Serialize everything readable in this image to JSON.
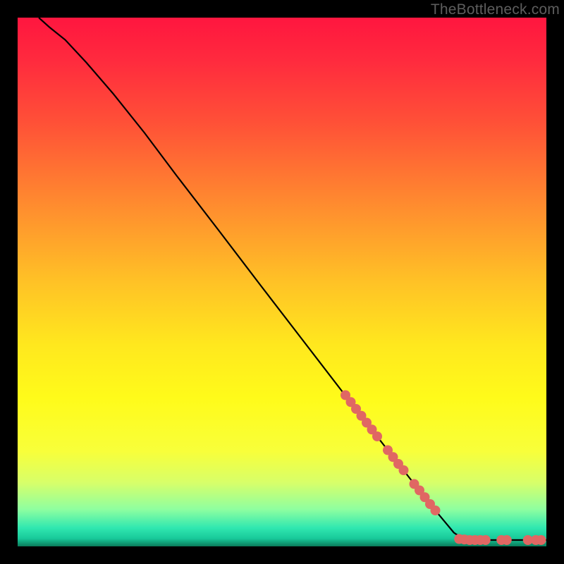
{
  "watermark": "TheBottleneck.com",
  "chart_data": {
    "type": "line",
    "title": "",
    "xlabel": "",
    "ylabel": "",
    "xlim": [
      0,
      100
    ],
    "ylim": [
      0,
      100
    ],
    "gradient_stops": [
      {
        "offset": 0.0,
        "color": "#ff163f"
      },
      {
        "offset": 0.08,
        "color": "#ff2a3e"
      },
      {
        "offset": 0.2,
        "color": "#ff5137"
      },
      {
        "offset": 0.35,
        "color": "#ff8a2f"
      },
      {
        "offset": 0.5,
        "color": "#ffc226"
      },
      {
        "offset": 0.62,
        "color": "#ffe81e"
      },
      {
        "offset": 0.72,
        "color": "#fffb1a"
      },
      {
        "offset": 0.82,
        "color": "#f8ff3a"
      },
      {
        "offset": 0.88,
        "color": "#d7ff6a"
      },
      {
        "offset": 0.93,
        "color": "#8effa0"
      },
      {
        "offset": 0.965,
        "color": "#30e7b0"
      },
      {
        "offset": 0.985,
        "color": "#18c99a"
      },
      {
        "offset": 1.0,
        "color": "#0a7a5a"
      }
    ],
    "curve": [
      {
        "x": 4.0,
        "y": 100.0
      },
      {
        "x": 6.0,
        "y": 98.2
      },
      {
        "x": 9.0,
        "y": 95.8
      },
      {
        "x": 13.0,
        "y": 91.5
      },
      {
        "x": 18.0,
        "y": 85.7
      },
      {
        "x": 24.0,
        "y": 78.2
      },
      {
        "x": 30.0,
        "y": 70.2
      },
      {
        "x": 38.0,
        "y": 59.8
      },
      {
        "x": 46.0,
        "y": 49.3
      },
      {
        "x": 54.0,
        "y": 38.9
      },
      {
        "x": 62.0,
        "y": 28.5
      },
      {
        "x": 70.0,
        "y": 18.2
      },
      {
        "x": 78.0,
        "y": 8.0
      },
      {
        "x": 82.5,
        "y": 2.6
      },
      {
        "x": 84.0,
        "y": 1.6
      },
      {
        "x": 86.0,
        "y": 1.2
      },
      {
        "x": 100.0,
        "y": 1.2
      }
    ],
    "markers": [
      {
        "x": 62.0,
        "y": 28.6
      },
      {
        "x": 63.0,
        "y": 27.3
      },
      {
        "x": 64.0,
        "y": 26.0
      },
      {
        "x": 65.0,
        "y": 24.7
      },
      {
        "x": 66.0,
        "y": 23.4
      },
      {
        "x": 67.0,
        "y": 22.1
      },
      {
        "x": 68.0,
        "y": 20.8
      },
      {
        "x": 70.0,
        "y": 18.2
      },
      {
        "x": 71.0,
        "y": 16.9
      },
      {
        "x": 72.0,
        "y": 15.6
      },
      {
        "x": 73.0,
        "y": 14.4
      },
      {
        "x": 75.0,
        "y": 11.8
      },
      {
        "x": 76.0,
        "y": 10.6
      },
      {
        "x": 77.0,
        "y": 9.3
      },
      {
        "x": 78.0,
        "y": 8.0
      },
      {
        "x": 79.0,
        "y": 6.8
      },
      {
        "x": 83.5,
        "y": 1.4
      },
      {
        "x": 84.5,
        "y": 1.3
      },
      {
        "x": 85.5,
        "y": 1.2
      },
      {
        "x": 86.5,
        "y": 1.2
      },
      {
        "x": 87.5,
        "y": 1.2
      },
      {
        "x": 88.5,
        "y": 1.2
      },
      {
        "x": 91.5,
        "y": 1.2
      },
      {
        "x": 92.5,
        "y": 1.2
      },
      {
        "x": 96.5,
        "y": 1.2
      },
      {
        "x": 98.0,
        "y": 1.2
      },
      {
        "x": 99.0,
        "y": 1.2
      }
    ],
    "marker_color": "#e06763",
    "marker_radius_px": 7
  }
}
